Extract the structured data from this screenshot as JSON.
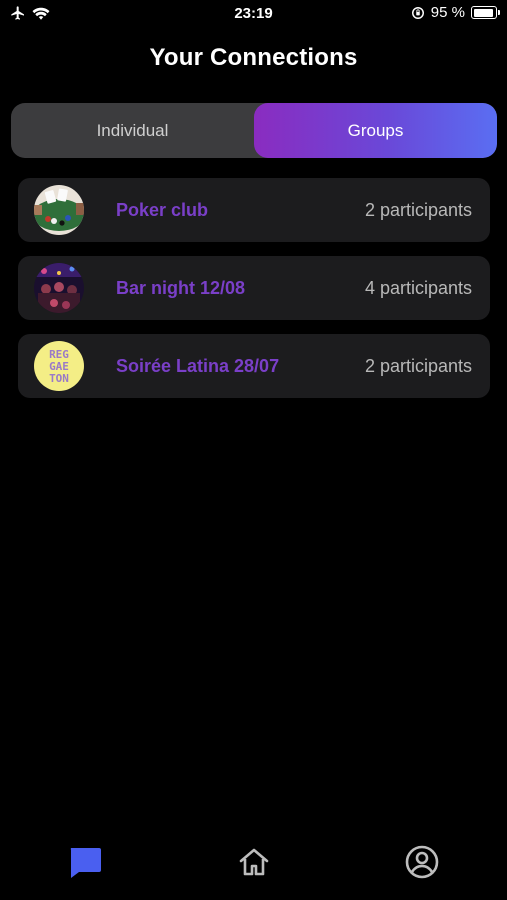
{
  "status_bar": {
    "time": "23:19",
    "battery": "95 %"
  },
  "header": {
    "title": "Your Connections"
  },
  "segments": [
    {
      "label": "Individual",
      "active": false
    },
    {
      "label": "Groups",
      "active": true
    }
  ],
  "groups": [
    {
      "name": "Poker club",
      "participants": "2 participants",
      "avatar": "poker-table-photo"
    },
    {
      "name": "Bar night 12/08",
      "participants": "4 participants",
      "avatar": "bar-crowd-photo"
    },
    {
      "name": "Soirée Latina 28/07",
      "participants": "2 participants",
      "avatar": "reggaeton-poster",
      "avatar_text": [
        "REG",
        "GAE",
        "TON"
      ]
    }
  ],
  "tabbar": [
    {
      "icon": "chat-icon",
      "active": true,
      "color": "#4a5ff0"
    },
    {
      "icon": "home-icon",
      "active": false,
      "color": "#bdbdbd"
    },
    {
      "icon": "profile-icon",
      "active": false,
      "color": "#bdbdbd"
    }
  ]
}
